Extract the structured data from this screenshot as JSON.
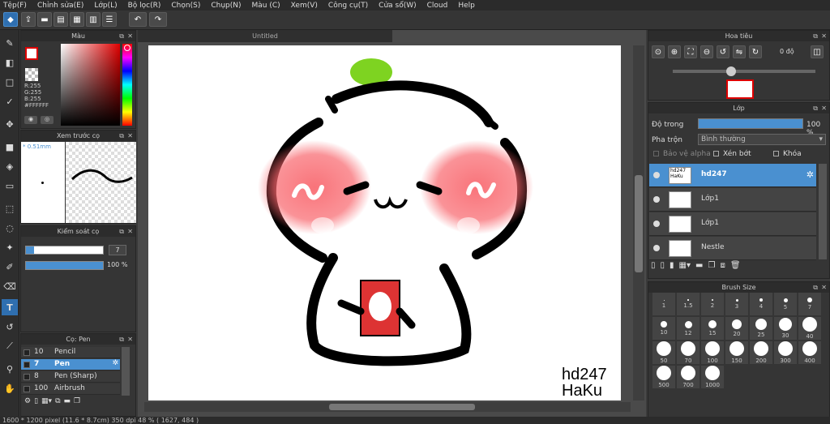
{
  "menu": [
    "Tệp(F)",
    "Chỉnh sửa(E)",
    "Lớp(L)",
    "Bộ lọc(R)",
    "Chọn(S)",
    "Chụp(N)",
    "Màu (C)",
    "Xem(V)",
    "Công cụ(T)",
    "Cửa sổ(W)",
    "Cloud",
    "Help"
  ],
  "document": {
    "tab_title": "Untitled"
  },
  "color_panel": {
    "title": "Màu",
    "r": "R:255",
    "g": "G:255",
    "b": "B:255",
    "hex": "#FFFFFF"
  },
  "brush_preview": {
    "title": "Xem trước cọ",
    "size": "* 0.51mm"
  },
  "brush_control": {
    "title": "Kiểm soát cọ",
    "size_value": "7",
    "opacity_value": "100 %"
  },
  "brush_list": {
    "title": "Cọ: Pen",
    "items": [
      {
        "size": "10",
        "name": "Pencil"
      },
      {
        "size": "7",
        "name": "Pen"
      },
      {
        "size": "8",
        "name": "Pen (Sharp)"
      },
      {
        "size": "100",
        "name": "Airbrush"
      }
    ]
  },
  "navigator": {
    "title": "Hoa tiêu",
    "angle": "0 độ"
  },
  "layers": {
    "title": "Lớp",
    "opacity_label": "Độ trong",
    "opacity_value": "100 %",
    "blend_label": "Pha trộn",
    "blend_value": "Bình thường",
    "protect_alpha": "Bảo vệ alpha",
    "clipping": "Xén bớt",
    "lock": "Khóa",
    "items": [
      {
        "name": "hd247",
        "thumb_text": "hd247 HaKu"
      },
      {
        "name": "Lớp1"
      },
      {
        "name": "Lớp1"
      },
      {
        "name": "Nestle"
      }
    ]
  },
  "brush_size": {
    "title": "Brush Size",
    "sizes": [
      "1",
      "1.5",
      "2",
      "3",
      "4",
      "5",
      "7",
      "10",
      "12",
      "15",
      "20",
      "25",
      "30",
      "40",
      "50",
      "70",
      "100",
      "150",
      "200",
      "300",
      "400",
      "500",
      "700",
      "1000"
    ]
  },
  "canvas": {
    "signature_line1": "hd247",
    "signature_line2": "HaKu"
  },
  "status": {
    "text": "1600 * 1200 pixel   (11.6 * 8.7cm)   350 dpi   48 %   ( 1627, 484 )"
  }
}
